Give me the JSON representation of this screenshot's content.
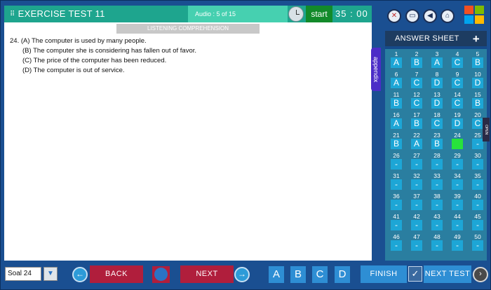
{
  "header": {
    "title": "EXERCISE TEST 11",
    "audio": "Audio : 5 of 15",
    "start_label": "start",
    "timer": "35 : 00"
  },
  "section_label": "LISTENING COMPREHENSION",
  "question": {
    "number_line": "24. (A) The computer is used by many people.",
    "options": [
      "(B) The computer she is considering has fallen out of favor.",
      "(C) The price of the computer has been reduced.",
      "(D) The computer is out of service."
    ]
  },
  "appendix_label": "appendix",
  "answer_sheet": {
    "title": "ANSWER SHEET",
    "plus": "+",
    "open_label": "OPEN",
    "cells": [
      {
        "n": "1",
        "a": "A"
      },
      {
        "n": "2",
        "a": "B"
      },
      {
        "n": "3",
        "a": "A"
      },
      {
        "n": "4",
        "a": "C"
      },
      {
        "n": "5",
        "a": "B"
      },
      {
        "n": "6",
        "a": "A"
      },
      {
        "n": "7",
        "a": "C"
      },
      {
        "n": "8",
        "a": "D"
      },
      {
        "n": "9",
        "a": "C"
      },
      {
        "n": "10",
        "a": "D"
      },
      {
        "n": "11",
        "a": "B"
      },
      {
        "n": "12",
        "a": "C"
      },
      {
        "n": "13",
        "a": "D"
      },
      {
        "n": "14",
        "a": "C"
      },
      {
        "n": "15",
        "a": "B"
      },
      {
        "n": "16",
        "a": "A"
      },
      {
        "n": "17",
        "a": "B"
      },
      {
        "n": "18",
        "a": "C"
      },
      {
        "n": "19",
        "a": "D"
      },
      {
        "n": "20",
        "a": "C"
      },
      {
        "n": "21",
        "a": "B"
      },
      {
        "n": "22",
        "a": "A"
      },
      {
        "n": "23",
        "a": "B"
      },
      {
        "n": "24",
        "a": ""
      },
      {
        "n": "25",
        "a": "-"
      },
      {
        "n": "26",
        "a": "-"
      },
      {
        "n": "27",
        "a": "-"
      },
      {
        "n": "28",
        "a": "-"
      },
      {
        "n": "29",
        "a": "-"
      },
      {
        "n": "30",
        "a": "-"
      },
      {
        "n": "31",
        "a": "-"
      },
      {
        "n": "32",
        "a": "-"
      },
      {
        "n": "33",
        "a": "-"
      },
      {
        "n": "34",
        "a": "-"
      },
      {
        "n": "35",
        "a": "-"
      },
      {
        "n": "36",
        "a": "-"
      },
      {
        "n": "37",
        "a": "-"
      },
      {
        "n": "38",
        "a": "-"
      },
      {
        "n": "39",
        "a": "-"
      },
      {
        "n": "40",
        "a": "-"
      },
      {
        "n": "41",
        "a": "-"
      },
      {
        "n": "42",
        "a": "-"
      },
      {
        "n": "43",
        "a": "-"
      },
      {
        "n": "44",
        "a": "-"
      },
      {
        "n": "45",
        "a": "-"
      },
      {
        "n": "46",
        "a": "-"
      },
      {
        "n": "47",
        "a": "-"
      },
      {
        "n": "48",
        "a": "-"
      },
      {
        "n": "49",
        "a": "-"
      },
      {
        "n": "50",
        "a": "-"
      }
    ],
    "current": "24"
  },
  "toolbar_icons": [
    "mute-icon",
    "book-icon",
    "send-icon",
    "home-icon",
    "windows-logo"
  ],
  "bottom": {
    "soal_value": "Soal 24",
    "prev_arrow": "←",
    "back_label": "BACK",
    "next_label": "NEXT",
    "next_arrow": "→",
    "letters": [
      "A",
      "B",
      "C",
      "D"
    ],
    "finish_label": "FINISH",
    "check": "✓",
    "next_test_label": "NEXT TEST",
    "next_test_arrow": "›"
  },
  "colors": {
    "accent_green": "#1ea58e",
    "button_red": "#b01e3c",
    "button_blue": "#2e8ed4",
    "current_answer": "#27e33b"
  }
}
